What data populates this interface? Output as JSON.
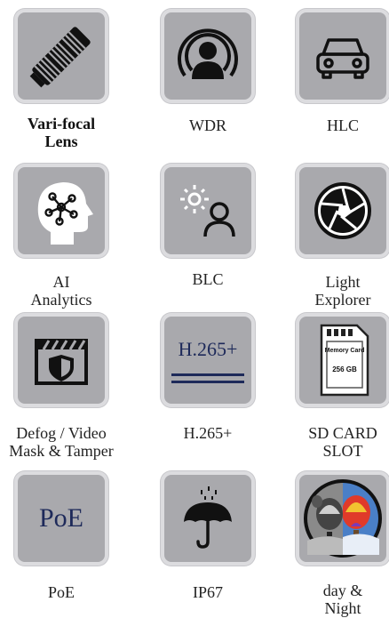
{
  "features": [
    {
      "id": "vari-focal",
      "label_line1": "Vari-focal",
      "label_line2": "Lens",
      "icon": "zoom-lens-icon",
      "bold": true
    },
    {
      "id": "wdr",
      "label_line1": "WDR",
      "label_line2": "",
      "icon": "wdr-person-icon"
    },
    {
      "id": "hlc",
      "label_line1": "HLC",
      "label_line2": "",
      "icon": "car-icon"
    },
    {
      "id": "ai",
      "label_line1": "AI",
      "label_line2": "Analytics",
      "icon": "ai-head-icon"
    },
    {
      "id": "blc",
      "label_line1": "BLC",
      "label_line2": "",
      "icon": "sun-person-icon"
    },
    {
      "id": "light",
      "label_line1": "Light",
      "label_line2": "Explorer",
      "icon": "aperture-icon"
    },
    {
      "id": "defog",
      "label_line1": "Defog / Video",
      "label_line2": "Mask & Tamper",
      "icon": "shield-clapper-icon"
    },
    {
      "id": "h265",
      "label_line1": "H.265+",
      "label_line2": "",
      "icon": "h265-icon",
      "tile_text": "H.265+"
    },
    {
      "id": "sdcard",
      "label_line1": "SD CARD",
      "label_line2": "SLOT",
      "icon": "sd-card-icon",
      "card_title": "Memory Card",
      "card_size": "256 GB"
    },
    {
      "id": "poe",
      "label_line1": "PoE",
      "label_line2": "",
      "icon": "poe-icon",
      "tile_text": "PoE"
    },
    {
      "id": "ip67",
      "label_line1": "IP67",
      "label_line2": "",
      "icon": "umbrella-rain-icon"
    },
    {
      "id": "daynight",
      "label_line1": "day &",
      "label_line2": "Night",
      "icon": "day-night-balloon-icon"
    }
  ],
  "colors": {
    "tile_bg": "#a9a9ad",
    "tile_border": "#dcdcdf",
    "icon_dark": "#111111",
    "text_navy": "#1e2a5a"
  }
}
